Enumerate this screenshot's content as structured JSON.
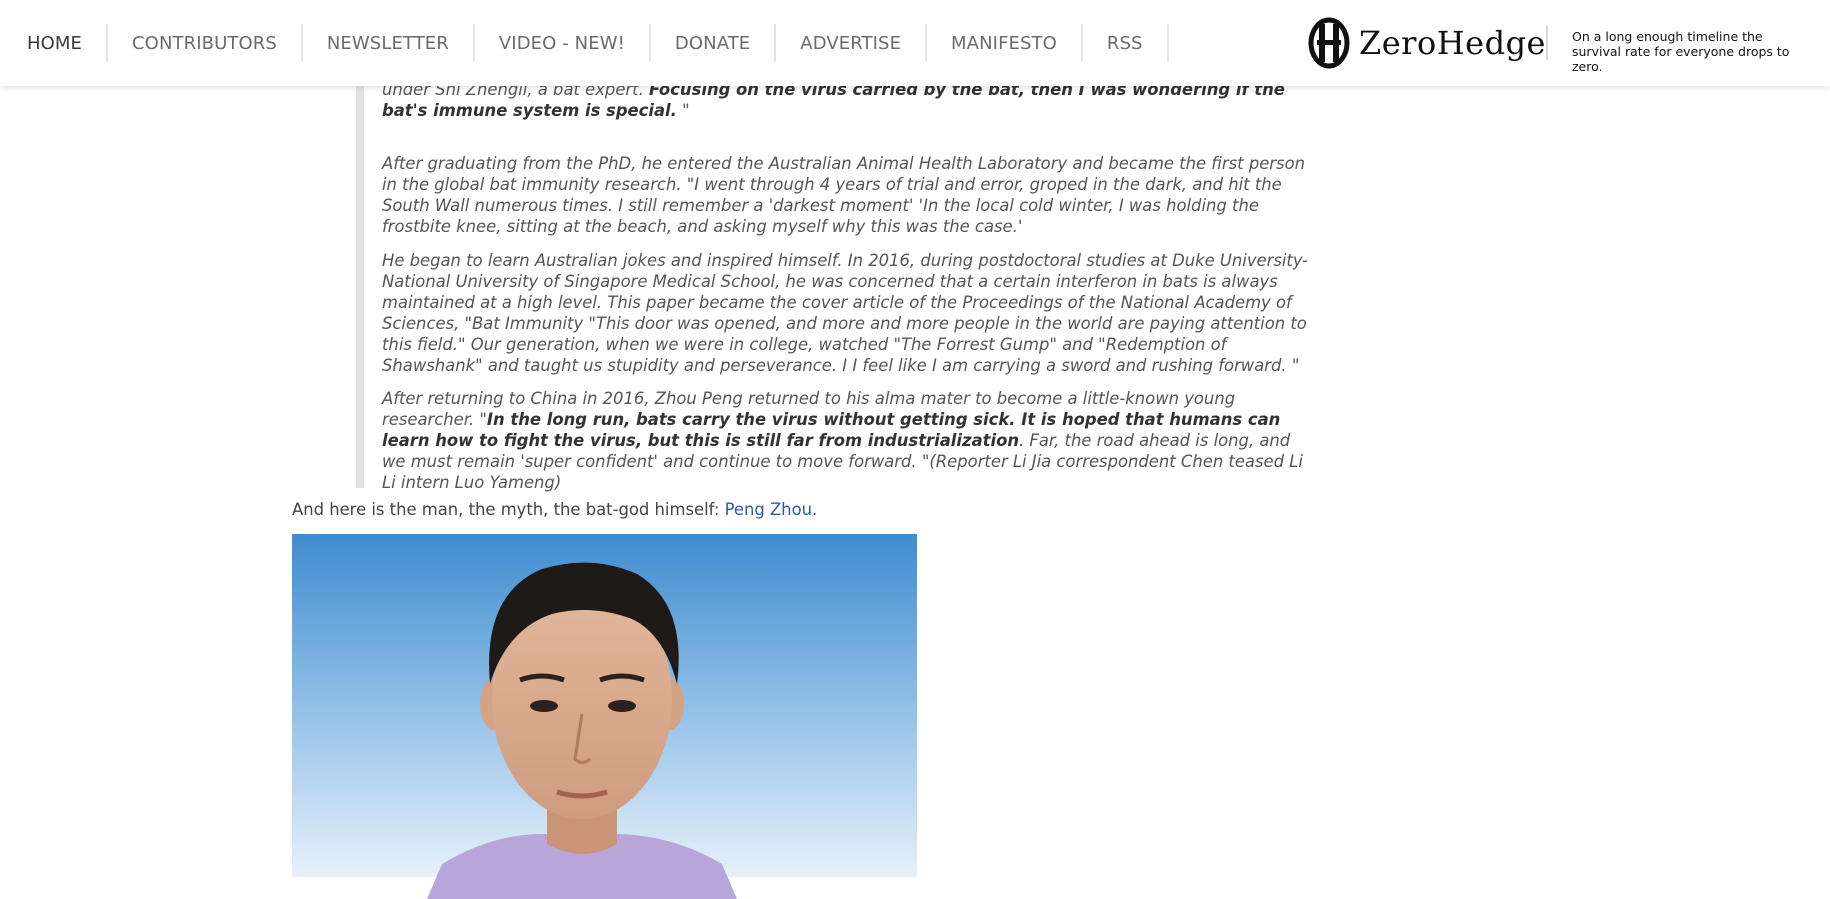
{
  "nav": {
    "items": [
      "HOME",
      "CONTRIBUTORS",
      "NEWSLETTER",
      "VIDEO - NEW!",
      "DONATE",
      "ADVERTISE",
      "MANIFESTO",
      "RSS"
    ]
  },
  "brand": {
    "name": "ZeroHedge",
    "tagline": "On a long enough timeline the survival rate for everyone drops to zero."
  },
  "article": {
    "p1": {
      "text": "the Wuhan Institute of Virology of the Chinese Academy of Sciences at the postgraduate level, and studied under Shi Zhengli, a bat expert. ",
      "bold": "Focusing on the virus carried by the bat, then I was wondering if the bat's immune system is special.",
      "tail": " \""
    },
    "p2": "After graduating from the PhD, he entered the Australian Animal Health Laboratory and became the first person in the global bat immunity research. \"I went through 4 years of trial and error, groped in the dark, and hit the South Wall numerous times. I still remember a 'darkest moment' 'In the local cold winter, I was holding the frostbite knee, sitting at the beach, and asking myself why this was the case.'",
    "p3": "He began to learn Australian jokes and inspired himself. In 2016, during postdoctoral studies at Duke University-National University of Singapore Medical School, he was concerned that a certain interferon in bats is always maintained at a high level. This paper became the cover article of the Proceedings of the National Academy of Sciences, \"Bat Immunity \"This door was opened, and more and more people in the world are paying attention to this field.\" Our generation, when we were in college, watched \"The Forrest Gump\" and \"Redemption of Shawshank\" and taught us stupidity and perseverance. I I feel like I am carrying a sword and rushing forward. \"",
    "p4": {
      "text": "After returning to China in 2016, Zhou Peng returned to his alma mater to become a little-known young researcher. \"",
      "bold": "In the long run, bats carry the virus without getting sick. It is hoped that humans can learn how to fight the virus, but this is still far from industrialization",
      "tail": ". Far, the road ahead is long, and we must remain 'super confident' and continue to move forward. \"(Reporter Li Jia correspondent Chen teased Li Li intern Luo Yameng)"
    },
    "intro_text": "And here is the man, the myth, the bat-god himself: ",
    "intro_link": "Peng Zhou",
    "intro_end": "."
  },
  "colors": {
    "nav_text": "#6b6b6b",
    "link": "#2c5aa0",
    "quote_bar": "#e2e2e2",
    "photo_sky": "#4a92d2",
    "shirt": "#b8a6d9"
  },
  "icons": [
    "zerohedge-logo-icon"
  ]
}
